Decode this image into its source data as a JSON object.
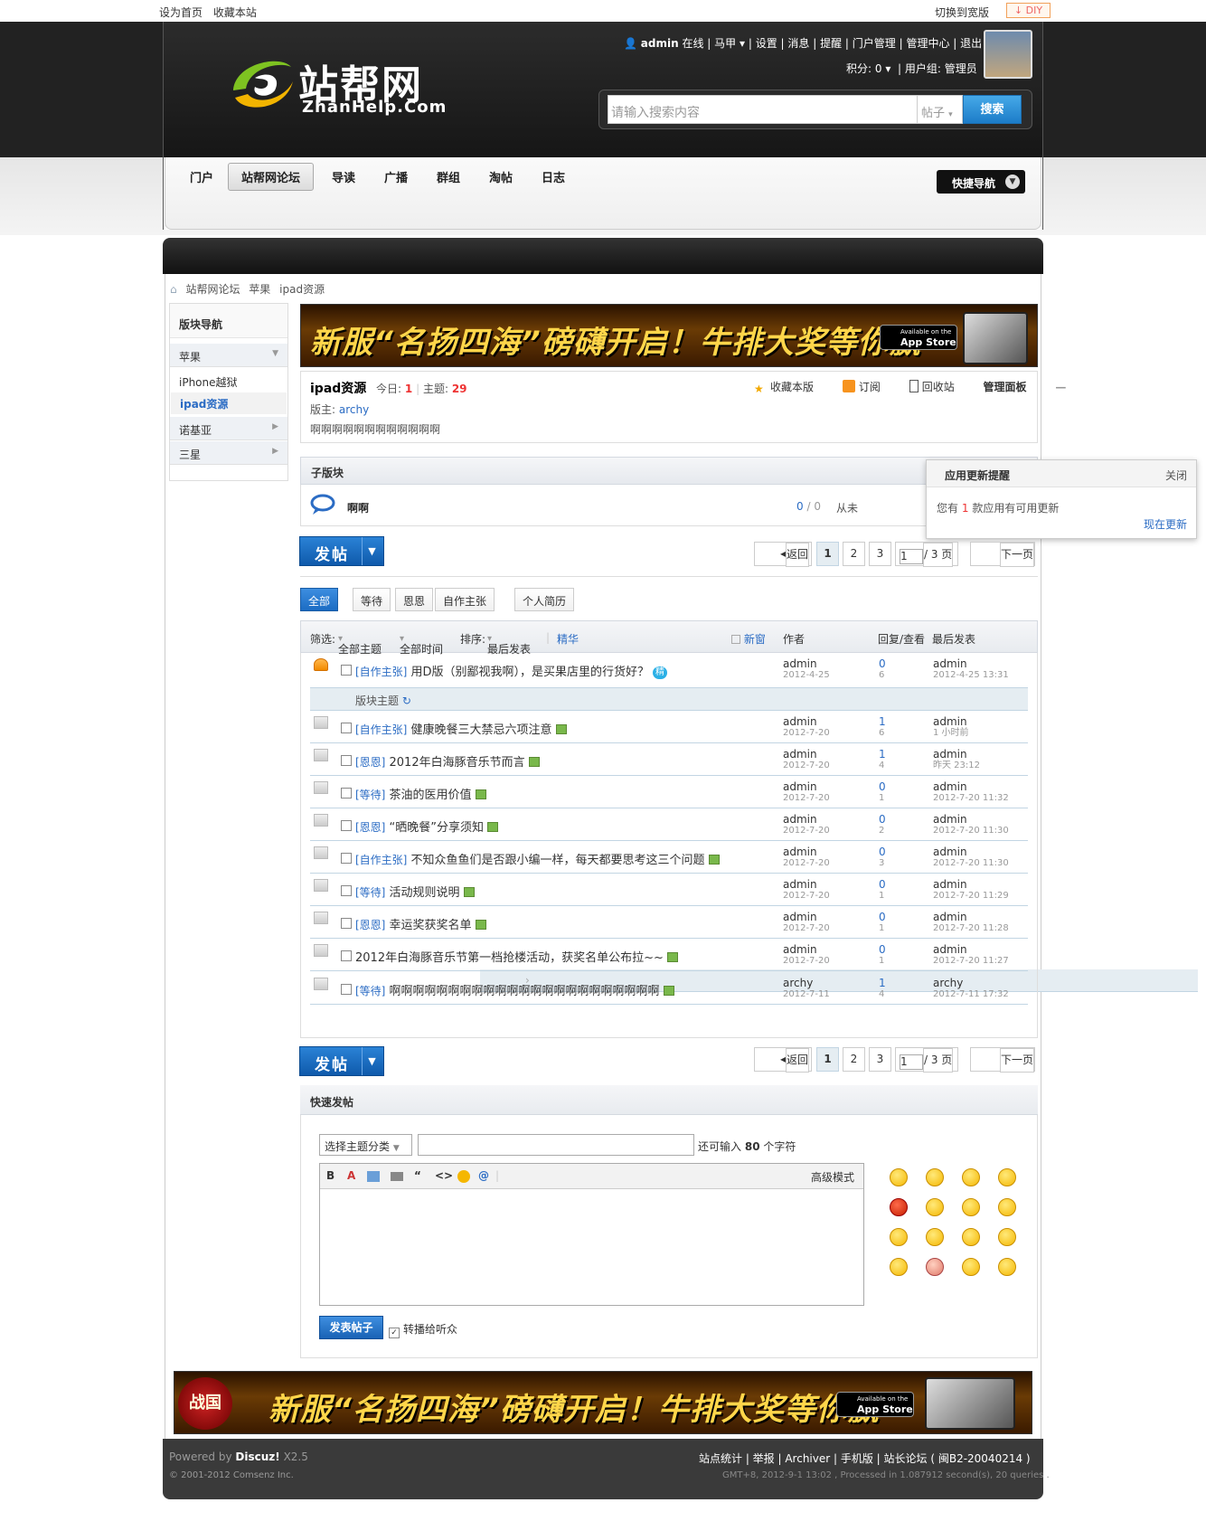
{
  "topbar": {
    "set_home": "设为首页",
    "bookmark": "收藏本站",
    "switch_width": "切换到宽版",
    "diy": "DIY"
  },
  "logo": {
    "cn": "站帮网",
    "en": "ZhanHelp.Com"
  },
  "user": {
    "name": "admin",
    "status": "在线",
    "majia": "马甲",
    "links": [
      "设置",
      "消息",
      "提醒",
      "门户管理",
      "管理中心",
      "退出"
    ],
    "credits": "积分: 0",
    "group": "用户组: 管理员"
  },
  "search": {
    "placeholder": "请输入搜索内容",
    "type": "帖子",
    "button": "搜索"
  },
  "nav": {
    "items": [
      "门户",
      "站帮网论坛",
      "导读",
      "广播",
      "群组",
      "淘帖",
      "日志"
    ],
    "active": "站帮网论坛",
    "quick": "快捷导航"
  },
  "breadcrumb": [
    "站帮网论坛",
    "苹果",
    "ipad资源"
  ],
  "sidebar": {
    "title": "版块导航",
    "groups": [
      "苹果",
      "诺基亚",
      "三星"
    ],
    "subs": [
      "iPhone越狱",
      "ipad资源"
    ],
    "current": "ipad资源"
  },
  "banner": {
    "text": "新服“名扬四海”磅礴开启！牛排大奖等你赢",
    "appstore_small": "Available on the",
    "appstore": "App Store",
    "seal": "战国"
  },
  "forum": {
    "name": "ipad资源",
    "today_label": "今日:",
    "today": "1",
    "topics_label": "主题:",
    "topics": "29",
    "mod_label": "版主:",
    "mod": "archy",
    "desc": "啊啊啊啊啊啊啊啊啊啊啊啊",
    "actions": [
      "收藏本版",
      "订阅",
      "回收站",
      "管理面板"
    ]
  },
  "subforum": {
    "title": "子版块",
    "name": "啊啊",
    "count": "0",
    "count2": "0",
    "last": "从未"
  },
  "popup": {
    "title": "应用更新提醒",
    "close": "关闭",
    "msg_pre": "您有",
    "num": "1",
    "msg_post": "款应用有可用更新",
    "link": "现在更新"
  },
  "post_button": "发帖",
  "pager": {
    "back": "返回",
    "pages": [
      "1",
      "2",
      "3"
    ],
    "input": "1",
    "total": "/ 3 页",
    "next": "下一页"
  },
  "tabs": [
    "全部",
    "等待",
    "恩恩",
    "自作主张",
    "个人简历"
  ],
  "filter": {
    "label": "筛选:",
    "all_topics": "全部主题",
    "all_time": "全部时间",
    "sort": "排序:",
    "sort_val": "最后发表",
    "digest": "精华",
    "newwin": "新窗",
    "author": "作者",
    "replies": "回复/查看",
    "last": "最后发表"
  },
  "sticky": {
    "type": "[自作主张]",
    "title": "用D版（别鄙视我啊），是买果店里的行货好？",
    "badge": "精",
    "author": "admin",
    "date": "2012-4-25",
    "replies": "0",
    "views": "6",
    "last_user": "admin",
    "last_time": "2012-4-25 13:31"
  },
  "section_label": "版块主题",
  "threads": [
    {
      "type": "[自作主张]",
      "title": "健康晚餐三大禁忌六项注意",
      "author": "admin",
      "date": "2012-7-20",
      "replies": "1",
      "views": "6",
      "last_user": "admin",
      "last_time": "1 小时前"
    },
    {
      "type": "[恩恩]",
      "title": "2012年白海豚音乐节而言",
      "author": "admin",
      "date": "2012-7-20",
      "replies": "1",
      "views": "4",
      "last_user": "admin",
      "last_time": "昨天 23:12"
    },
    {
      "type": "[等待]",
      "title": "茶油的医用价值",
      "author": "admin",
      "date": "2012-7-20",
      "replies": "0",
      "views": "1",
      "last_user": "admin",
      "last_time": "2012-7-20 11:32"
    },
    {
      "type": "[恩恩]",
      "title": "“晒晚餐”分享须知",
      "author": "admin",
      "date": "2012-7-20",
      "replies": "0",
      "views": "2",
      "last_user": "admin",
      "last_time": "2012-7-20 11:30"
    },
    {
      "type": "[自作主张]",
      "title": "不知众鱼鱼们是否跟小编一样，每天都要思考这三个问题",
      "author": "admin",
      "date": "2012-7-20",
      "replies": "0",
      "views": "3",
      "last_user": "admin",
      "last_time": "2012-7-20 11:30"
    },
    {
      "type": "[等待]",
      "title": "活动规则说明",
      "author": "admin",
      "date": "2012-7-20",
      "replies": "0",
      "views": "1",
      "last_user": "admin",
      "last_time": "2012-7-20 11:29"
    },
    {
      "type": "[恩恩]",
      "title": "幸运奖获奖名单",
      "author": "admin",
      "date": "2012-7-20",
      "replies": "0",
      "views": "1",
      "last_user": "admin",
      "last_time": "2012-7-20 11:28"
    },
    {
      "type": "",
      "title": "2012年白海豚音乐节第一档抢楼活动，获奖名单公布拉~~",
      "author": "admin",
      "date": "2012-7-20",
      "replies": "0",
      "views": "1",
      "last_user": "admin",
      "last_time": "2012-7-20 11:27"
    },
    {
      "type": "[等待]",
      "title": "啊啊啊啊啊啊啊啊啊啊啊啊啊啊啊啊啊啊啊啊啊啊啊",
      "author": "archy",
      "date": "2012-7-11",
      "replies": "1",
      "views": "4",
      "last_user": "archy",
      "last_time": "2012-7-11 17:32"
    }
  ],
  "quickpost": {
    "title": "快速发帖",
    "select": "选择主题分类",
    "hint_pre": "还可输入",
    "hint_num": "80",
    "hint_post": "个字符",
    "advanced": "高级模式",
    "submit": "发表帖子",
    "relay": "转播给听众"
  },
  "footer": {
    "powered": "Powered by",
    "brand": "Discuz!",
    "ver": "X2.5",
    "copy": "© 2001-2012 Comsenz Inc.",
    "links": "站点统计 | 举报 | Archiver | 手机版 | 站长论坛 ( 闽B2-20040214 )",
    "info": "GMT+8, 2012-9-1 13:02 , Processed in 1.087912 second(s), 20 queries ."
  }
}
